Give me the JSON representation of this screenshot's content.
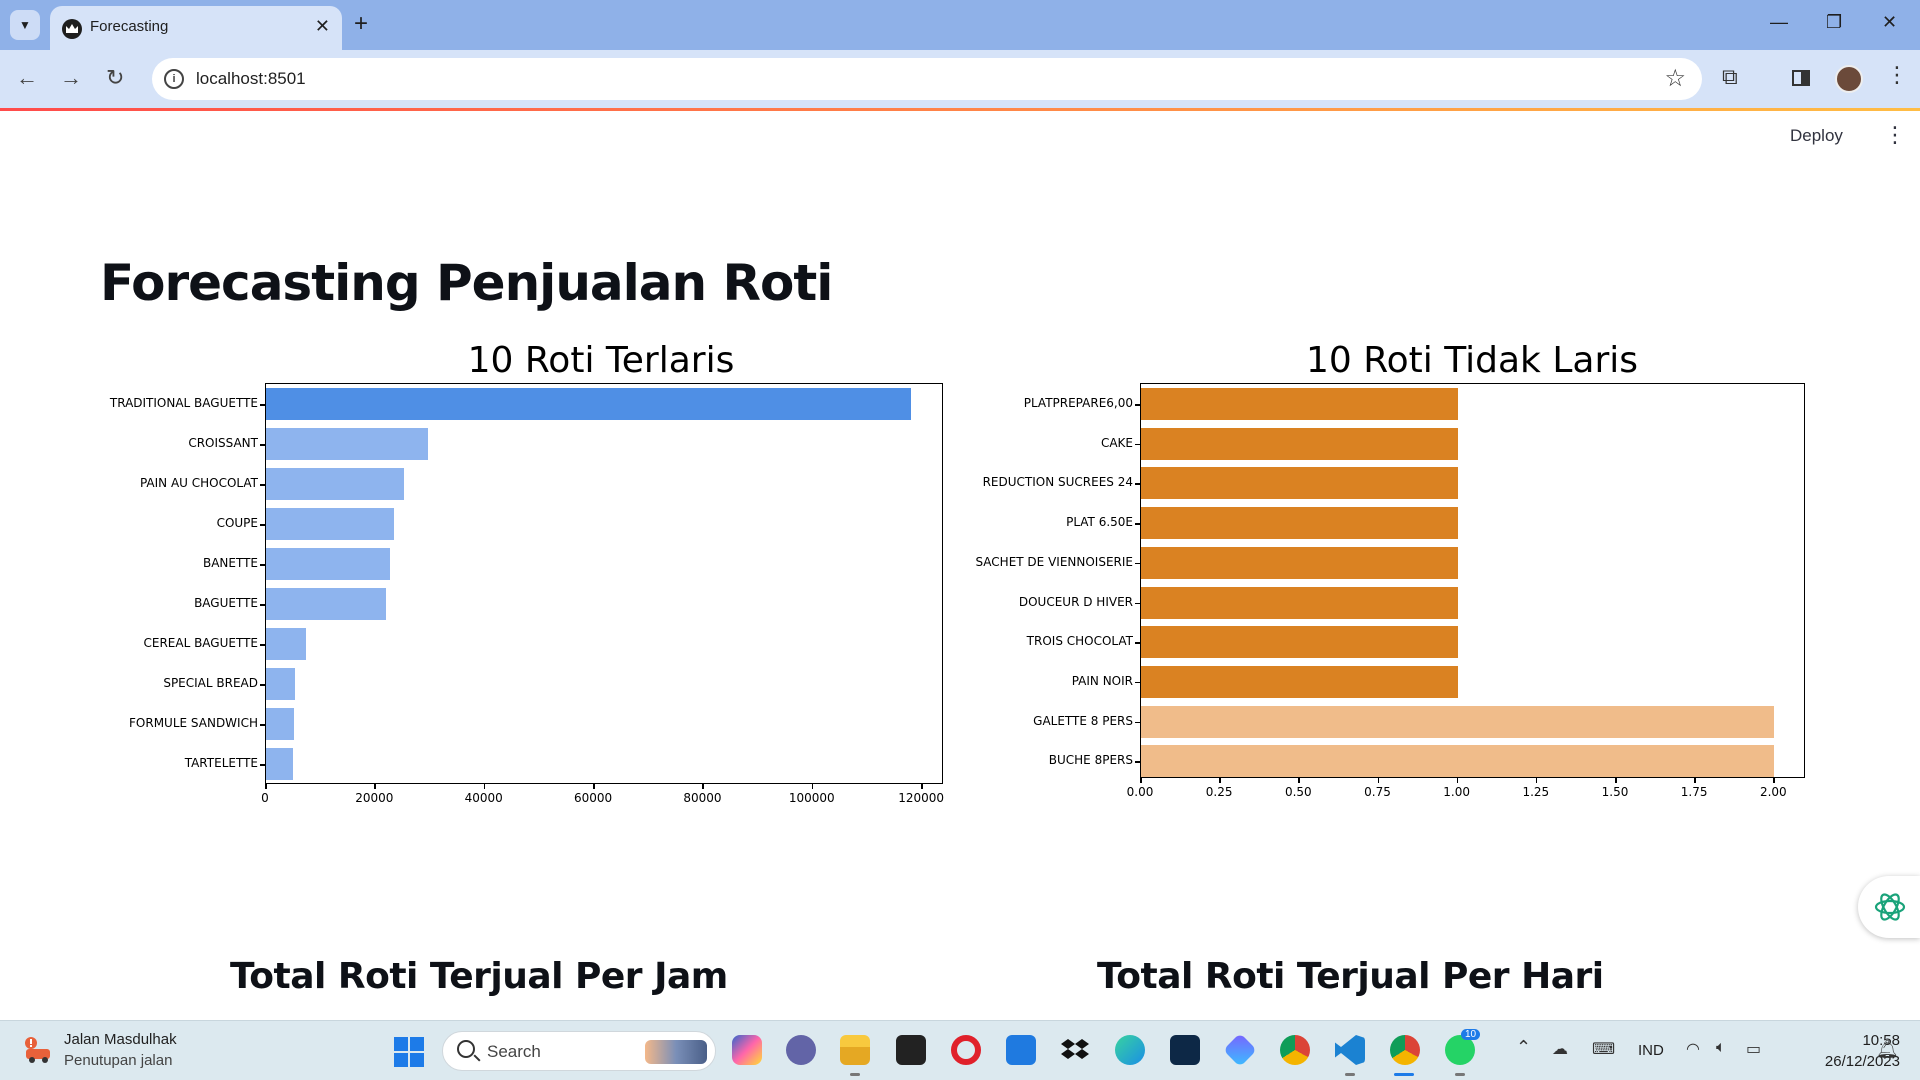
{
  "browser": {
    "tab_title": "Forecasting",
    "tab_close": "✕",
    "new_tab": "+",
    "url": "localhost:8501",
    "window_controls": {
      "minimize": "—",
      "restore": "❐",
      "close": "✕"
    },
    "icons": [
      "tab-search-icon",
      "favicon-crown-icon",
      "back-icon",
      "forward-icon",
      "reload-icon",
      "site-info-icon",
      "bookmark-star-icon",
      "extensions-icon",
      "side-panel-icon",
      "profile-avatar",
      "chrome-menu-icon"
    ]
  },
  "app": {
    "deploy_label": "Deploy",
    "menu_glyph": "⋮",
    "title": "Forecasting Penjualan Roti",
    "section_hourly": "Total Roti Terjual Per Jam",
    "section_daily": "Total Roti Terjual Per Hari"
  },
  "chart_data": [
    {
      "type": "bar",
      "orientation": "horizontal",
      "title": "10 Roti Terlaris",
      "categories": [
        "TRADITIONAL BAGUETTE",
        "CROISSANT",
        "PAIN AU CHOCOLAT",
        "COUPE",
        "BANETTE",
        "BAGUETTE",
        "CEREAL BAGUETTE",
        "SPECIAL BREAD",
        "FORMULE SANDWICH",
        "TARTELETTE"
      ],
      "values": [
        117900,
        29600,
        25200,
        23400,
        22700,
        22000,
        7300,
        5300,
        5100,
        5000
      ],
      "xticks": [
        "0",
        "20000",
        "40000",
        "60000",
        "80000",
        "100000",
        "120000"
      ],
      "xlim": [
        0,
        124000
      ],
      "colors": [
        "#4f8fe5",
        "#8eb4ee",
        "#8eb4ee",
        "#8eb4ee",
        "#8eb4ee",
        "#8eb4ee",
        "#8eb4ee",
        "#8eb4ee",
        "#8eb4ee",
        "#8eb4ee"
      ],
      "grid": false
    },
    {
      "type": "bar",
      "orientation": "horizontal",
      "title": "10 Roti Tidak Laris",
      "categories": [
        "PLATPREPARE6,00",
        "CAKE",
        "REDUCTION SUCREES 24",
        "PLAT 6.50E",
        "SACHET DE VIENNOISERIE",
        "DOUCEUR D HIVER",
        "TROIS CHOCOLAT",
        "PAIN NOIR",
        "GALETTE 8 PERS",
        "BUCHE 8PERS"
      ],
      "values": [
        1,
        1,
        1,
        1,
        1,
        1,
        1,
        1,
        2,
        2
      ],
      "xticks": [
        "0.00",
        "0.25",
        "0.50",
        "0.75",
        "1.00",
        "1.25",
        "1.50",
        "1.75",
        "2.00"
      ],
      "xlim": [
        0,
        2.1
      ],
      "colors": [
        "#da8222",
        "#da8222",
        "#da8222",
        "#da8222",
        "#da8222",
        "#da8222",
        "#da8222",
        "#da8222",
        "#f0bc8a",
        "#f0bc8a"
      ],
      "grid": false
    }
  ],
  "taskbar": {
    "weather_title": "Jalan Masdulhak",
    "weather_subtitle": "Penutupan jalan",
    "search_placeholder": "Search",
    "language": "IND",
    "time": "10:58",
    "date": "26/12/2023",
    "whatsapp_badge": "10",
    "apps": [
      "copilot-icon",
      "teams-meet-icon",
      "file-explorer-icon",
      "sticky-notes-icon",
      "opera-icon",
      "mail-icon",
      "dropbox-icon",
      "edge-icon",
      "terminal-icon",
      "copilot-app-icon",
      "chrome-icon",
      "vscode-icon",
      "chrome-profile-icon",
      "whatsapp-icon"
    ]
  }
}
